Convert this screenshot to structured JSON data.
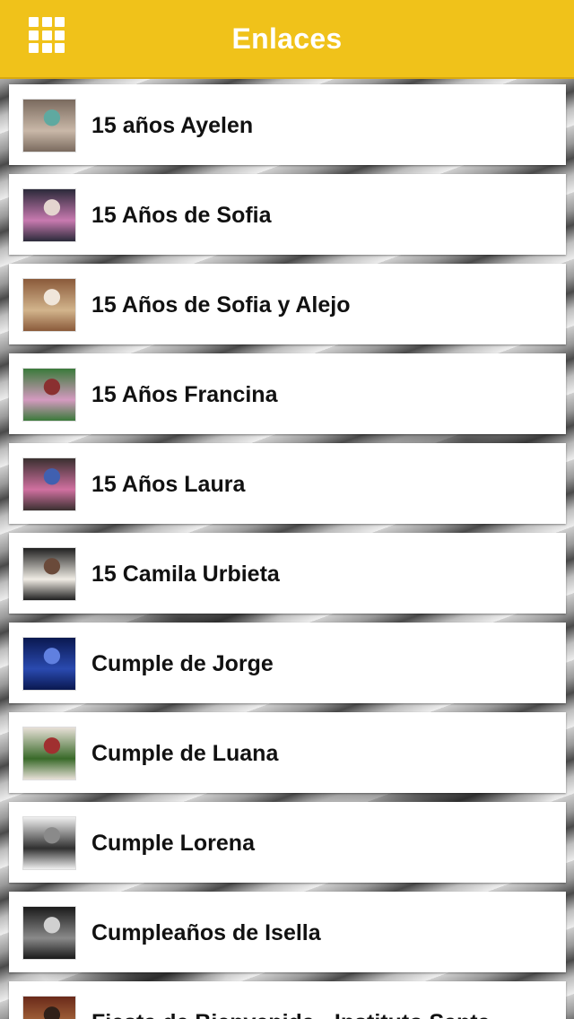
{
  "header": {
    "title": "Enlaces",
    "menu_icon": "grid-menu-icon",
    "background_color": "#f0c21a"
  },
  "items": [
    {
      "label": "15 años Ayelen",
      "thumb_colors": [
        "#7a6a5e",
        "#c9b8a8",
        "#5fa9a0"
      ]
    },
    {
      "label": "15 Años de Sofia",
      "thumb_colors": [
        "#2b2a3a",
        "#c87ab0",
        "#e4d5cf"
      ]
    },
    {
      "label": "15 Años de Sofia y Alejo",
      "thumb_colors": [
        "#8a5a3a",
        "#d2b48c",
        "#f0e6da"
      ]
    },
    {
      "label": "15 Años Francina",
      "thumb_colors": [
        "#3a7a3a",
        "#d49ac0",
        "#8a3030"
      ]
    },
    {
      "label": "15 Años Laura",
      "thumb_colors": [
        "#3a3030",
        "#d070a0",
        "#4060b0"
      ]
    },
    {
      "label": "15 Camila Urbieta",
      "thumb_colors": [
        "#202020",
        "#f0ece4",
        "#6a4a3a"
      ]
    },
    {
      "label": "Cumple de Jorge",
      "thumb_colors": [
        "#0a1850",
        "#2a4ab0",
        "#6080e0"
      ]
    },
    {
      "label": "Cumple de Luana",
      "thumb_colors": [
        "#e8e0d8",
        "#3a6a2a",
        "#a03030"
      ]
    },
    {
      "label": "Cumple Lorena",
      "thumb_colors": [
        "#f0f0f0",
        "#303030",
        "#8a8a8a"
      ]
    },
    {
      "label": "Cumpleaños de Isella",
      "thumb_colors": [
        "#1a1a1a",
        "#8a8a8a",
        "#d0d0d0"
      ]
    },
    {
      "label": "Fiesta de Bienvenida - Instituto Santa",
      "thumb_colors": [
        "#6a2a1a",
        "#b07040",
        "#302018"
      ]
    }
  ]
}
